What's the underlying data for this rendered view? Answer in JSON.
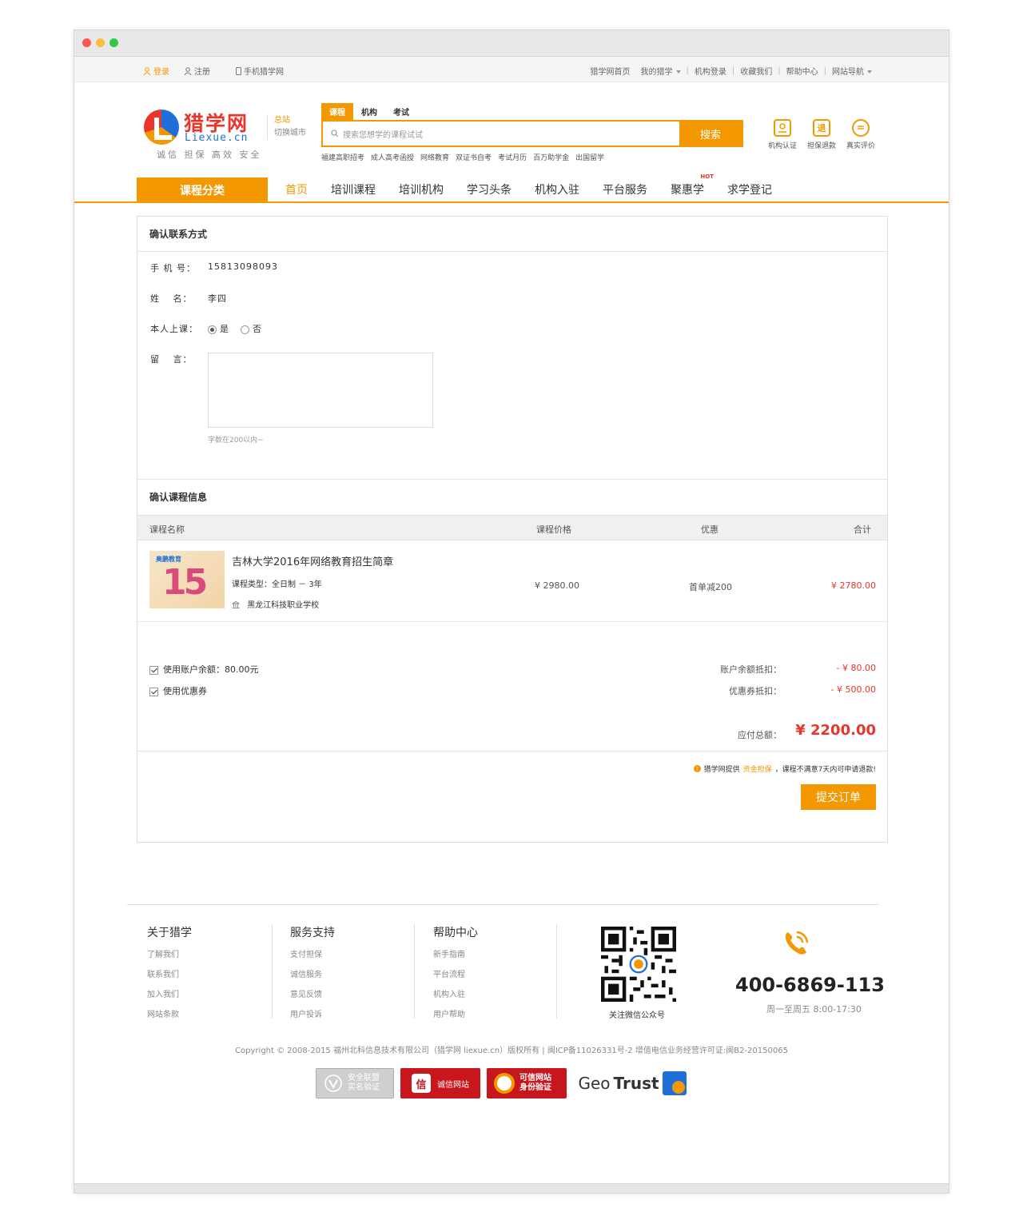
{
  "topbar": {
    "login": "登录",
    "register": "注册",
    "mobile": "手机猎学网",
    "links": [
      "猎学网首页",
      "我的猎学",
      "机构登录",
      "收藏我们",
      "帮助中心",
      "网站导航"
    ]
  },
  "logo": {
    "cn": "猎学网",
    "en": "Liexue.cn",
    "slogan": "诚信 担保 高效 安全"
  },
  "city": {
    "main": "总站",
    "switch": "切换城市"
  },
  "search": {
    "tabs": [
      "课程",
      "机构",
      "考试"
    ],
    "placeholder": "搜索您想学的课程试试",
    "button": "搜索",
    "hot": [
      "福建高职招考",
      "成人高考函授",
      "网络教育",
      "双证书自考",
      "考试月历",
      "百万助学金",
      "出国留学"
    ]
  },
  "badges": [
    "机构认证",
    "担保退款",
    "真实评价"
  ],
  "nav": {
    "category": "课程分类",
    "items": [
      "首页",
      "培训课程",
      "培训机构",
      "学习头条",
      "机构入驻",
      "平台服务",
      "聚惠学",
      "求学登记"
    ],
    "hot_tag": "HOT"
  },
  "contact": {
    "title": "确认联系方式",
    "phone_label": "手 机 号：",
    "phone": "15813098093",
    "name_label": "姓　 名：",
    "name": "李四",
    "self_label": "本人上课：",
    "opt_yes": "是",
    "opt_no": "否",
    "msg_label": "留　 言：",
    "hint": "字数在200以内~"
  },
  "course": {
    "title": "确认课程信息",
    "headers": [
      "课程名称",
      "课程价格",
      "优惠",
      "合计"
    ],
    "thumb_brand": "奥鹏教育",
    "thumb_num": "15",
    "name": "吉林大学2016年网络教育招生简章",
    "type": "课程类型：全日制 － 3年",
    "school": "黑龙江科技职业学校",
    "price": "¥ 2980.00",
    "discount": "首单减200",
    "total": "¥ 2780.00"
  },
  "payment": {
    "balance_opt": "使用账户余额：80.00元",
    "coupon_opt": "使用优惠券",
    "balance_label": "账户余额抵扣：",
    "balance_val": "- ¥ 80.00",
    "coupon_label": "优惠券抵扣：",
    "coupon_val": "- ¥ 500.00",
    "total_label": "应付总额：",
    "total_val": "¥ 2200.00",
    "notice_a": "猎学网提供",
    "notice_hl": "资金担保",
    "notice_b": "，课程不满意7天内可申请退款!",
    "submit": "提交订单"
  },
  "footer": {
    "cols": [
      {
        "title": "关于猎学",
        "links": [
          "了解我们",
          "联系我们",
          "加入我们",
          "网站条款"
        ]
      },
      {
        "title": "服务支持",
        "links": [
          "支付担保",
          "诚信服务",
          "意见反馈",
          "用户投诉"
        ]
      },
      {
        "title": "帮助中心",
        "links": [
          "新手指南",
          "平台流程",
          "机构入驻",
          "用户帮助"
        ]
      }
    ],
    "qr_caption": "关注微信公众号",
    "phone": "400-6869-113",
    "hours": "周一至周五 8:00-17:30",
    "copyright": "Copyright © 2008-2015 福州北科信息技术有限公司（猎学网 liexue.cn）版权所有 | 闽ICP备11026331号-2 增值电信业务经营许可证:闽B2-20150065",
    "certs": {
      "c1": "安全联盟 实名验证",
      "c2_seal": "信",
      "c2": "诚信网站",
      "c3": "可信网站 身份验证",
      "c4_a": "Geo",
      "c4_b": "Trust"
    }
  },
  "colors": {
    "accent": "#f39800",
    "price_red": "#e9352b"
  }
}
